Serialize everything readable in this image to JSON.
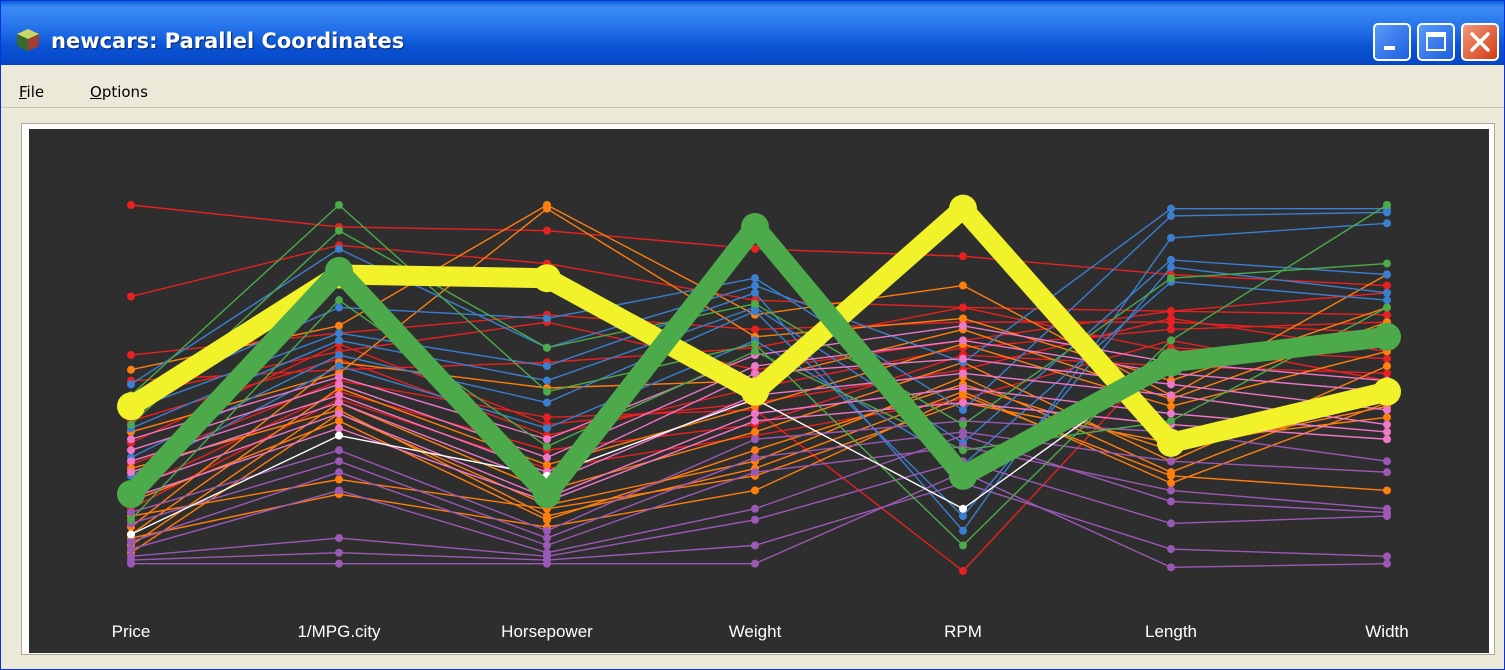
{
  "window": {
    "title": "newcars: Parallel Coordinates",
    "icon": "r-cube-icon"
  },
  "menu": {
    "items": [
      {
        "mnemonic": "F",
        "rest": "ile"
      },
      {
        "mnemonic": "O",
        "rest": "ptions"
      }
    ]
  },
  "colors": {
    "background": "#2e2e2e",
    "highlight_yellow": "#f2f22a",
    "highlight_green": "#4caa4a"
  },
  "chart_data": {
    "type": "parallel_coordinates",
    "axes": [
      "Price",
      "1/MPG.city",
      "Horsepower",
      "Weight",
      "RPM",
      "Length",
      "Width"
    ],
    "normalized": true,
    "ylim": [
      0,
      1
    ],
    "highlighted": [
      {
        "color": "#f2f22a",
        "values": [
          0.45,
          0.81,
          0.8,
          0.49,
          0.99,
          0.35,
          0.49
        ]
      },
      {
        "color": "#4caa4a",
        "values": [
          0.21,
          0.82,
          0.21,
          0.94,
          0.26,
          0.57,
          0.64
        ]
      }
    ],
    "series": [
      {
        "color": "#e82020",
        "values": [
          1.0,
          0.94,
          0.93,
          0.88,
          0.86,
          0.81,
          0.78
        ]
      },
      {
        "color": "#e82020",
        "values": [
          0.75,
          0.89,
          0.84,
          0.74,
          0.72,
          0.71,
          0.76
        ]
      },
      {
        "color": "#e82020",
        "values": [
          0.59,
          0.65,
          0.7,
          0.66,
          0.68,
          0.68,
          0.65
        ]
      },
      {
        "color": "#e82020",
        "values": [
          0.52,
          0.55,
          0.57,
          0.61,
          0.72,
          0.6,
          0.62
        ]
      },
      {
        "color": "#e82020",
        "values": [
          0.48,
          0.6,
          0.68,
          0.55,
          0.63,
          0.71,
          0.7
        ]
      },
      {
        "color": "#e82020",
        "values": [
          0.41,
          0.58,
          0.37,
          0.5,
          0.61,
          0.66,
          0.68
        ]
      },
      {
        "color": "#e82020",
        "values": [
          0.35,
          0.62,
          0.4,
          0.46,
          0.55,
          0.69,
          0.6
        ]
      },
      {
        "color": "#e82020",
        "values": [
          0.29,
          0.52,
          0.42,
          0.44,
          0.0,
          0.61,
          0.58
        ]
      },
      {
        "color": "#e82020",
        "values": [
          0.22,
          0.49,
          0.33,
          0.4,
          0.59,
          0.56,
          0.54
        ]
      },
      {
        "color": "#e82020",
        "values": [
          0.17,
          0.47,
          0.28,
          0.37,
          0.47,
          0.63,
          0.52
        ]
      },
      {
        "color": "#ff7f0e",
        "values": [
          0.55,
          0.67,
          1.0,
          0.7,
          0.78,
          0.48,
          0.81
        ]
      },
      {
        "color": "#ff7f0e",
        "values": [
          0.38,
          0.54,
          0.99,
          0.64,
          0.69,
          0.52,
          0.72
        ]
      },
      {
        "color": "#ff7f0e",
        "values": [
          0.12,
          0.57,
          0.5,
          0.52,
          0.66,
          0.47,
          0.68
        ]
      },
      {
        "color": "#ff7f0e",
        "values": [
          0.1,
          0.5,
          0.29,
          0.45,
          0.62,
          0.45,
          0.6
        ]
      },
      {
        "color": "#ff7f0e",
        "values": [
          0.07,
          0.46,
          0.22,
          0.38,
          0.57,
          0.3,
          0.56
        ]
      },
      {
        "color": "#ff7f0e",
        "values": [
          0.05,
          0.43,
          0.18,
          0.3,
          0.53,
          0.27,
          0.5
        ]
      },
      {
        "color": "#ff7f0e",
        "values": [
          0.28,
          0.44,
          0.15,
          0.28,
          0.49,
          0.24,
          0.46
        ]
      },
      {
        "color": "#ff7f0e",
        "values": [
          0.19,
          0.41,
          0.14,
          0.33,
          0.51,
          0.33,
          0.45
        ]
      },
      {
        "color": "#ff7f0e",
        "values": [
          0.15,
          0.25,
          0.17,
          0.26,
          0.46,
          0.35,
          0.42
        ]
      },
      {
        "color": "#ff7f0e",
        "values": [
          0.09,
          0.21,
          0.12,
          0.22,
          0.48,
          0.26,
          0.22
        ]
      },
      {
        "color": "#3a7fd0",
        "values": [
          0.51,
          0.88,
          0.61,
          0.78,
          0.57,
          0.99,
          0.99
        ]
      },
      {
        "color": "#3a7fd0",
        "values": [
          0.47,
          0.72,
          0.69,
          0.8,
          0.44,
          0.97,
          0.98
        ]
      },
      {
        "color": "#3a7fd0",
        "values": [
          0.44,
          0.65,
          0.56,
          0.76,
          0.11,
          0.91,
          0.95
        ]
      },
      {
        "color": "#3a7fd0",
        "values": [
          0.39,
          0.63,
          0.52,
          0.72,
          0.35,
          0.85,
          0.81
        ]
      },
      {
        "color": "#3a7fd0",
        "values": [
          0.31,
          0.59,
          0.46,
          0.71,
          0.15,
          0.83,
          0.76
        ]
      },
      {
        "color": "#3a7fd0",
        "values": [
          0.26,
          0.56,
          0.39,
          0.63,
          0.29,
          0.79,
          0.74
        ]
      },
      {
        "color": "#ee77c8",
        "values": [
          0.36,
          0.53,
          0.36,
          0.59,
          0.67,
          0.57,
          0.52
        ]
      },
      {
        "color": "#ee77c8",
        "values": [
          0.33,
          0.51,
          0.31,
          0.56,
          0.63,
          0.54,
          0.49
        ]
      },
      {
        "color": "#ee77c8",
        "values": [
          0.3,
          0.48,
          0.27,
          0.54,
          0.58,
          0.51,
          0.44
        ]
      },
      {
        "color": "#ee77c8",
        "values": [
          0.27,
          0.46,
          0.24,
          0.48,
          0.54,
          0.48,
          0.4
        ]
      },
      {
        "color": "#ee77c8",
        "values": [
          0.23,
          0.43,
          0.2,
          0.43,
          0.5,
          0.43,
          0.38
        ]
      },
      {
        "color": "#ee77c8",
        "values": [
          0.2,
          0.39,
          0.19,
          0.41,
          0.46,
          0.4,
          0.36
        ]
      },
      {
        "color": "#9b59b6",
        "values": [
          0.16,
          0.33,
          0.11,
          0.36,
          0.41,
          0.38,
          0.3
        ]
      },
      {
        "color": "#9b59b6",
        "values": [
          0.13,
          0.3,
          0.09,
          0.31,
          0.38,
          0.3,
          0.27
        ]
      },
      {
        "color": "#9b59b6",
        "values": [
          0.08,
          0.27,
          0.07,
          0.27,
          0.34,
          0.22,
          0.17
        ]
      },
      {
        "color": "#9b59b6",
        "values": [
          0.06,
          0.22,
          0.05,
          0.17,
          0.37,
          0.19,
          0.16
        ]
      },
      {
        "color": "#9b59b6",
        "values": [
          0.04,
          0.09,
          0.04,
          0.14,
          0.3,
          0.13,
          0.15
        ]
      },
      {
        "color": "#9b59b6",
        "values": [
          0.03,
          0.05,
          0.03,
          0.07,
          0.24,
          0.06,
          0.04
        ]
      },
      {
        "color": "#9b59b6",
        "values": [
          0.02,
          0.02,
          0.02,
          0.02,
          0.27,
          0.01,
          0.02
        ]
      },
      {
        "color": "#4caa4a",
        "values": [
          0.48,
          1.0,
          0.49,
          0.62,
          0.07,
          0.63,
          1.0
        ]
      },
      {
        "color": "#4caa4a",
        "values": [
          0.4,
          0.93,
          0.61,
          0.73,
          0.4,
          0.8,
          0.84
        ]
      },
      {
        "color": "#4caa4a",
        "values": [
          0.14,
          0.74,
          0.34,
          0.6,
          0.33,
          0.41,
          0.72
        ]
      },
      {
        "color": "#ffffff",
        "values": [
          0.1,
          0.37,
          0.26,
          0.47,
          0.17,
          0.58,
          0.63
        ]
      }
    ]
  }
}
